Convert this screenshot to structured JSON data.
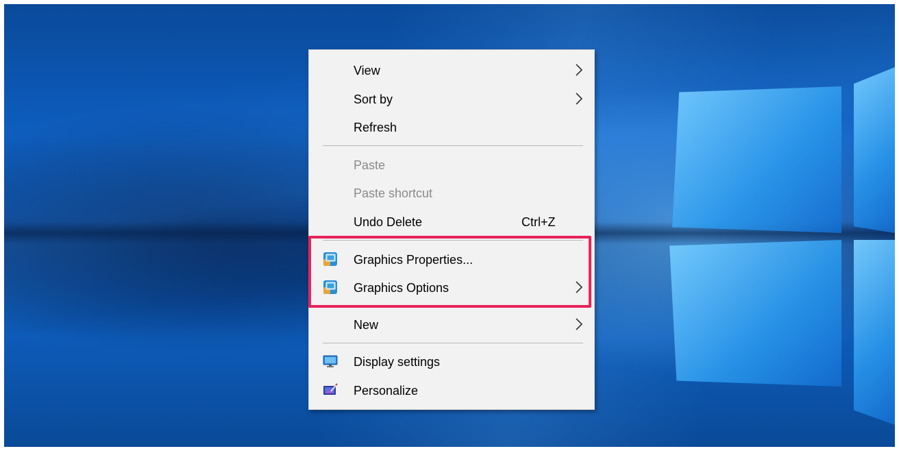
{
  "desktop": {
    "wallpaper": "windows-10-hero"
  },
  "context_menu": {
    "items": [
      {
        "label": "View",
        "submenu": true
      },
      {
        "label": "Sort by",
        "submenu": true
      },
      {
        "label": "Refresh"
      },
      {
        "label": "Paste",
        "disabled": true
      },
      {
        "label": "Paste shortcut",
        "disabled": true
      },
      {
        "label": "Undo Delete",
        "shortcut": "Ctrl+Z"
      },
      {
        "label": "Graphics Properties...",
        "icon": "intel-graphics-icon"
      },
      {
        "label": "Graphics Options",
        "icon": "intel-graphics-icon",
        "submenu": true
      },
      {
        "label": "New",
        "submenu": true
      },
      {
        "label": "Display settings",
        "icon": "display-settings-icon"
      },
      {
        "label": "Personalize",
        "icon": "personalize-icon"
      }
    ]
  },
  "annotation": {
    "highlight_color": "#e8235a"
  },
  "colors": {
    "menu_background": "#f2f2f2",
    "disabled_text": "#8a8a8a",
    "separator": "#b8b8b8"
  }
}
